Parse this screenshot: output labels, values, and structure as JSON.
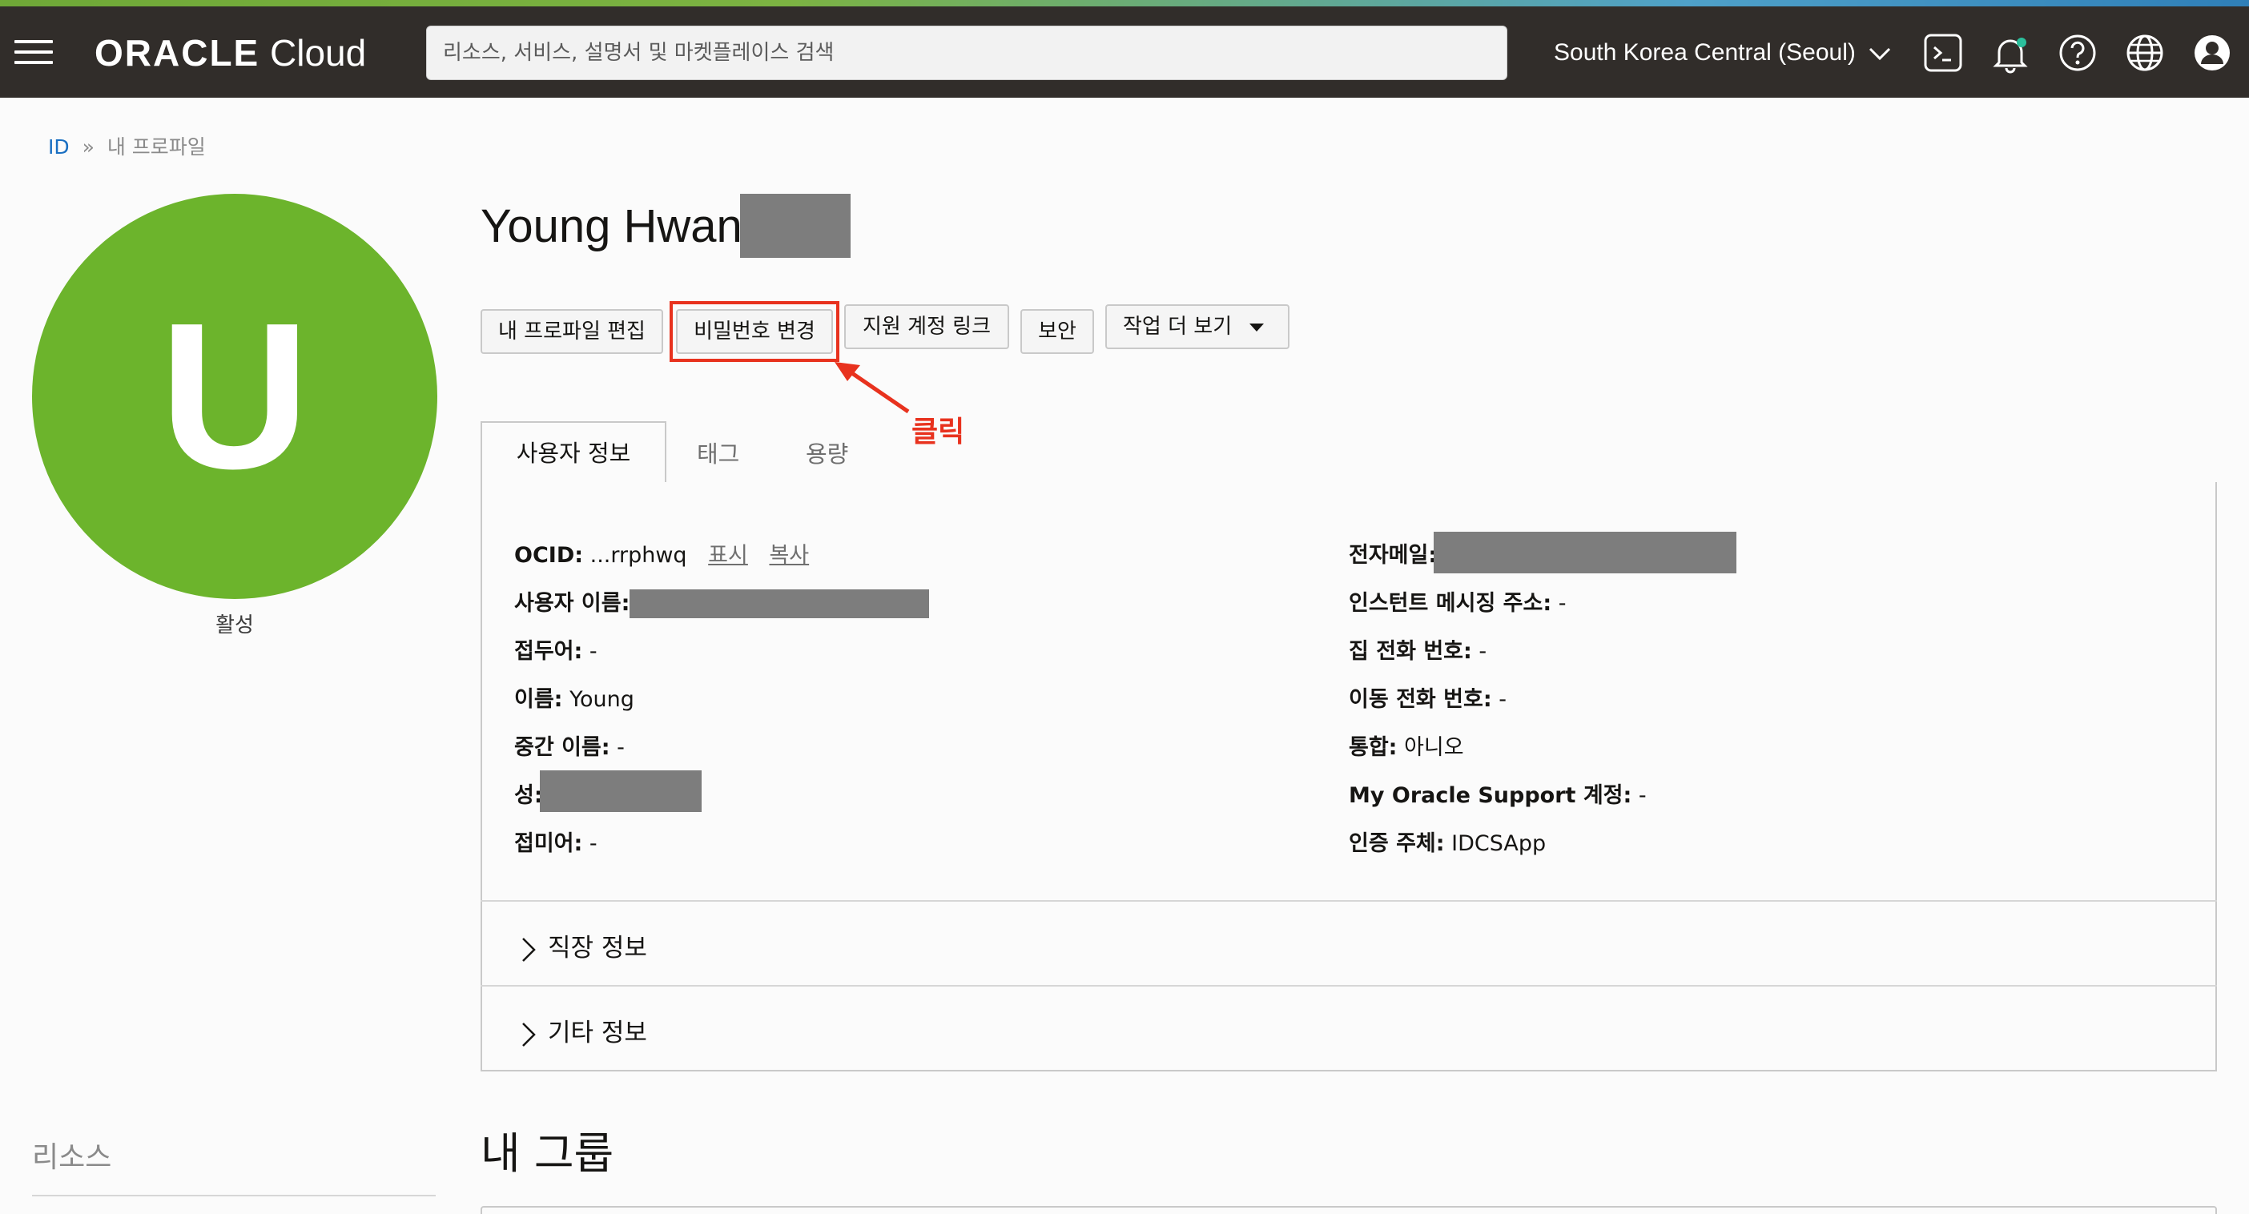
{
  "header": {
    "logo_brand": "ORACLE",
    "logo_product": "Cloud",
    "search_placeholder": "리소스, 서비스, 설명서 및 마켓플레이스 검색",
    "region": "South Korea Central (Seoul)",
    "icons": [
      "menu-icon",
      "cloud-shell-icon",
      "bell-icon",
      "help-icon",
      "globe-icon",
      "user-icon"
    ]
  },
  "breadcrumb": {
    "root": "ID",
    "separator": "»",
    "current": "내 프로파일"
  },
  "sidebar": {
    "avatar_letter": "U",
    "status": "활성",
    "resources_title": "리소스"
  },
  "profile": {
    "name": "Young Hwan"
  },
  "actions": {
    "edit_profile": "내 프로파일 편집",
    "change_password": "비밀번호 변경",
    "link_support": "지원 계정 링크",
    "security": "보안",
    "more_actions": "작업 더 보기"
  },
  "annotation": {
    "label": "클릭"
  },
  "tabs": {
    "user_info": "사용자 정보",
    "tags": "태그",
    "usage": "용량"
  },
  "user_info": {
    "left": {
      "ocid_label": "OCID:",
      "ocid_value": "...rrphwq",
      "ocid_show": "표시",
      "ocid_copy": "복사",
      "username_label": "사용자 이름:",
      "prefix_label": "접두어:",
      "prefix_value": "-",
      "first_label": "이름:",
      "first_value": "Young",
      "middle_label": "중간 이름:",
      "middle_value": "-",
      "last_label": "성:",
      "suffix_label": "접미어:",
      "suffix_value": "-"
    },
    "right": {
      "email_label": "전자메일:",
      "im_label": "인스턴트 메시징 주소:",
      "im_value": "-",
      "home_label": "집 전화 번호:",
      "home_value": "-",
      "mobile_label": "이동 전화 번호:",
      "mobile_value": "-",
      "federated_label": "통합:",
      "federated_value": "아니오",
      "mos_label": "My Oracle Support 계정:",
      "mos_value": "-",
      "auth_label": "인증 주체:",
      "auth_value": "IDCSApp"
    }
  },
  "sections": {
    "job_info": "직장 정보",
    "other_info": "기타 정보"
  },
  "groups": {
    "title": "내 그룹"
  },
  "colors": {
    "accent_red": "#e8321e",
    "avatar_green": "#6cb42c",
    "link_blue": "#1a6fc2",
    "header_bg": "#312d2a"
  }
}
